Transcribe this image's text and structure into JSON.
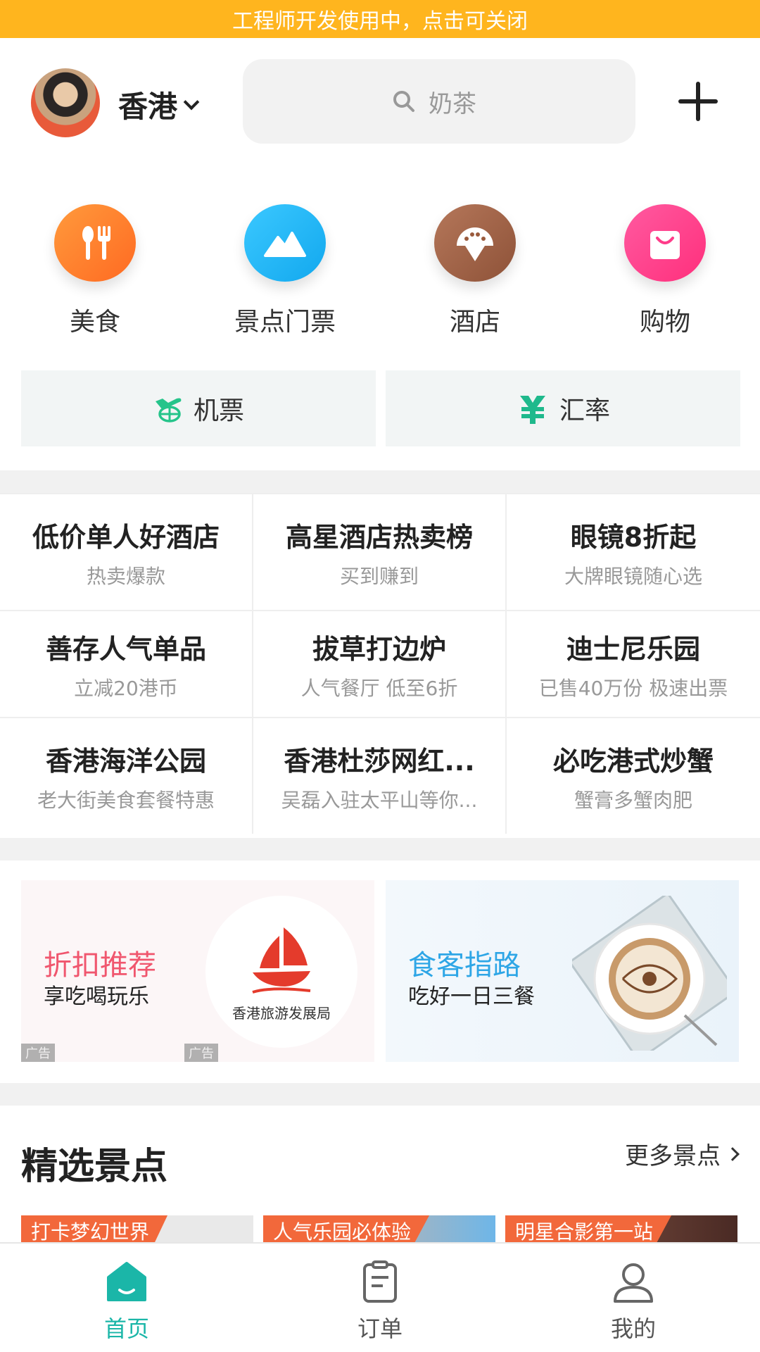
{
  "dev_banner": "工程师开发使用中，点击可关闭",
  "header": {
    "city": "香港",
    "search_placeholder": "奶茶"
  },
  "categories": [
    {
      "label": "美食",
      "icon": "food-icon",
      "color": "#FF7A2E"
    },
    {
      "label": "景点门票",
      "icon": "mountain-icon",
      "color": "#1FB4F5"
    },
    {
      "label": "酒店",
      "icon": "hotel-icon",
      "color": "#9A5B3D"
    },
    {
      "label": "购物",
      "icon": "shopping-bag-icon",
      "color": "#FF3C8A"
    }
  ],
  "quick": [
    {
      "label": "机票",
      "icon": "plane-icon"
    },
    {
      "label": "汇率",
      "icon": "yen-icon"
    }
  ],
  "grid": [
    [
      {
        "title": "低价单人好酒店",
        "sub": "热卖爆款"
      },
      {
        "title": "高星酒店热卖榜",
        "sub": "买到赚到"
      },
      {
        "title": "眼镜8折起",
        "sub": "大牌眼镜随心选"
      }
    ],
    [
      {
        "title": "善存人气单品",
        "sub": "立减20港币"
      },
      {
        "title": "拔草打边炉",
        "sub": "人气餐厅 低至6折"
      },
      {
        "title": "迪士尼乐园",
        "sub": "已售40万份 极速出票"
      }
    ],
    [
      {
        "title": "香港海洋公园",
        "sub": "老大街美食套餐特惠"
      },
      {
        "title": "香港杜莎网红...",
        "sub": "吴磊入驻太平山等你..."
      },
      {
        "title": "必吃港式炒蟹",
        "sub": "蟹膏多蟹肉肥"
      }
    ]
  ],
  "banners": [
    {
      "title": "折扣推荐",
      "sub": "享吃喝玩乐",
      "title_color": "#F0566E",
      "logo_text": "香港旅游发展局",
      "ad": "广告"
    },
    {
      "title": "食客指路",
      "sub": "吃好一日三餐",
      "title_color": "#2EA6E6"
    }
  ],
  "section": {
    "title": "精选景点",
    "more": "更多景点"
  },
  "cards": [
    {
      "tag": "打卡梦幻世界"
    },
    {
      "tag": "人气乐园必体验"
    },
    {
      "tag": "明星合影第一站"
    }
  ],
  "tabs": [
    {
      "label": "首页",
      "active": true
    },
    {
      "label": "订单",
      "active": false
    },
    {
      "label": "我的",
      "active": false
    }
  ],
  "colors": {
    "accent": "#1BB6A8",
    "banner_yellow": "#FFB51E"
  }
}
